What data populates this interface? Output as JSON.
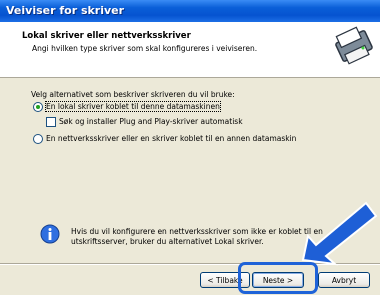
{
  "window": {
    "title": "Veiviser for skriver"
  },
  "header": {
    "title": "Lokal skriver eller nettverksskriver",
    "subtitle": "Angi hvilken type skriver som skal konfigureres i veiviseren.",
    "logo_icon": "printer-wizard-icon"
  },
  "main": {
    "prompt": "Velg alternativet som beskriver skriveren du vil bruke:",
    "option_local": {
      "label": "En lokal skriver koblet til denne datamaskinen",
      "selected": true
    },
    "plug_and_play": {
      "label": "Søk og installer Plug and Play-skriver automatisk",
      "checked": false
    },
    "option_network": {
      "label": "En nettverksskriver eller en skriver koblet til en annen datamaskin",
      "selected": false
    },
    "info_line1": "Hvis du vil konfigurere en nettverksskriver som ikke er koblet til en",
    "info_line2": "utskriftsserver, bruker du alternativet Lokal skriver.",
    "info_icon": "info-icon"
  },
  "footer": {
    "back_label": "< Tilbake",
    "next_label": "Neste >",
    "cancel_label": "Avbryt"
  },
  "colors": {
    "titlebar": "#0653d0",
    "highlight": "#1f63d8",
    "arrow": "#1e5fd6"
  }
}
